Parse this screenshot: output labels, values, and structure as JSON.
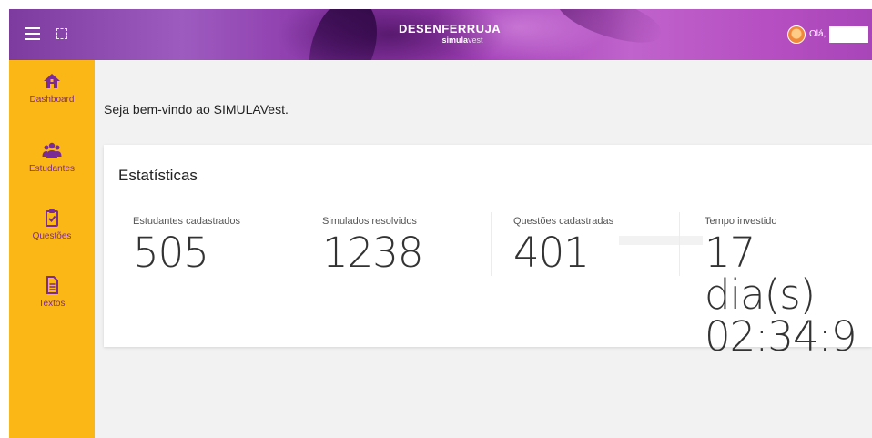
{
  "header": {
    "brand_main": "DESENFERRUJA",
    "brand_sub_bold": "simula",
    "brand_sub_light": "vest",
    "greeting": "Olá,",
    "colors": {
      "primary": "#9d4bb8",
      "accent": "#fbb715",
      "nav_text": "#7b2b95"
    },
    "icons": [
      "menu-icon",
      "expand-icon",
      "avatar"
    ]
  },
  "sidebar": {
    "items": [
      {
        "label": "Dashboard",
        "icon": "home-icon"
      },
      {
        "label": "Estudantes",
        "icon": "users-icon"
      },
      {
        "label": "Questões",
        "icon": "clipboard-check-icon"
      },
      {
        "label": "Textos",
        "icon": "document-icon"
      }
    ]
  },
  "main": {
    "welcome": "Seja bem-vindo ao SIMULAVest.",
    "card_title": "Estatísticas",
    "stats": [
      {
        "label": "Estudantes cadastrados",
        "value": "505"
      },
      {
        "label": "Simulados resolvidos",
        "value": "1238"
      },
      {
        "label": "Questões cadastradas",
        "value": "401"
      },
      {
        "label": "Tempo investido",
        "value_line1": "17 dia(s)",
        "value_line2": "02:34:9"
      }
    ]
  }
}
